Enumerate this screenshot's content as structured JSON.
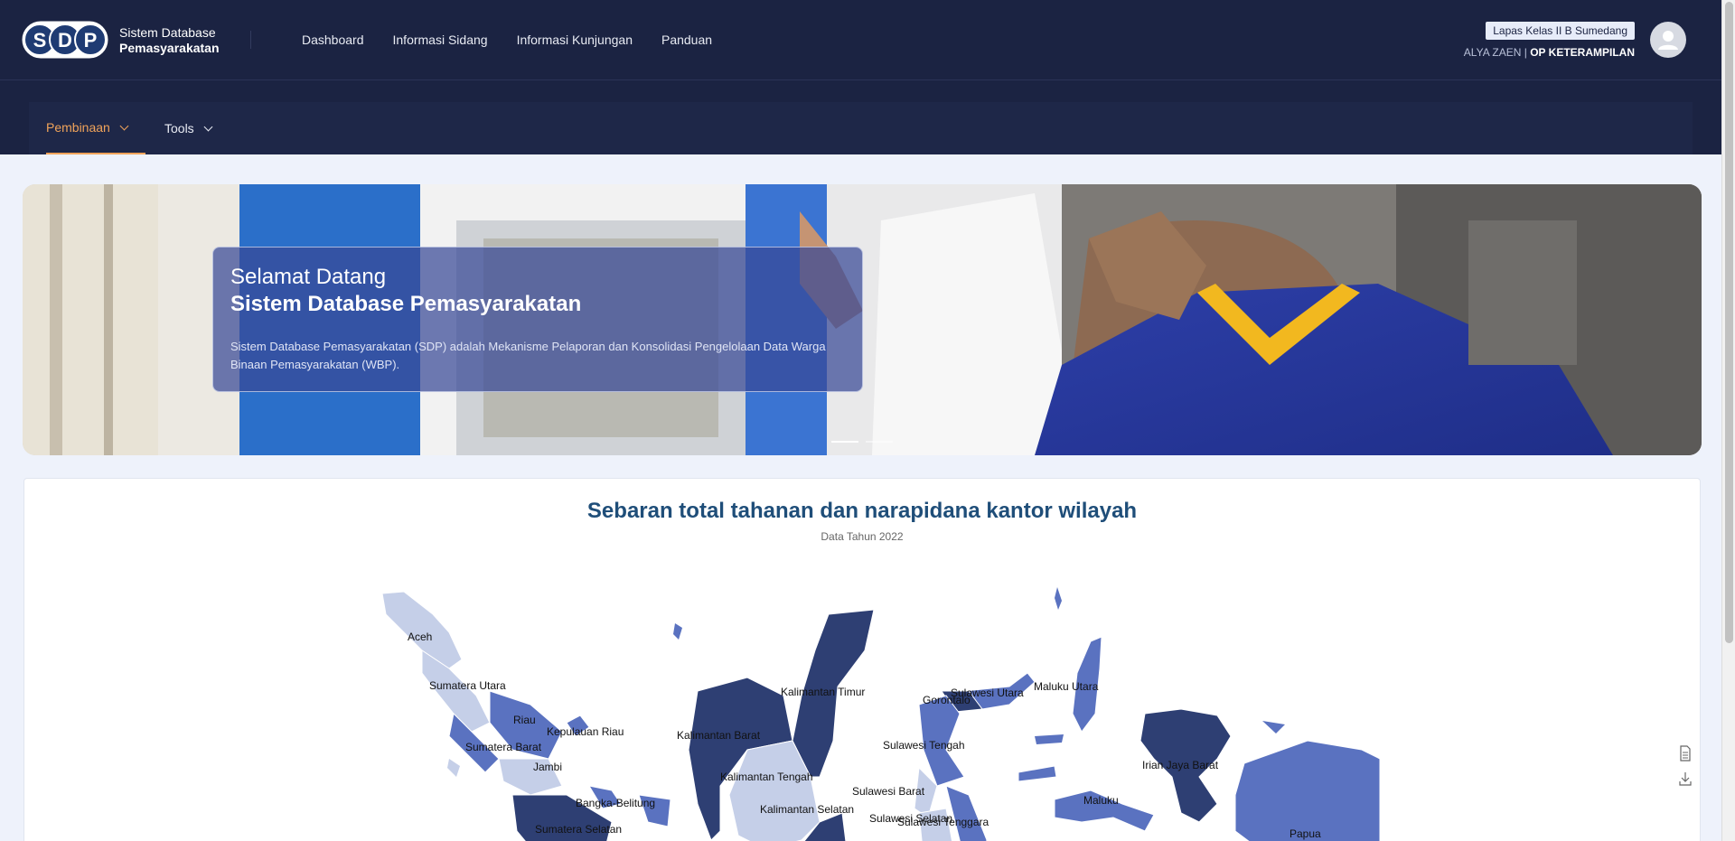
{
  "header": {
    "logo_text": "SDP",
    "brand_line1": "Sistem Database",
    "brand_line2": "Pemasyarakatan",
    "nav": [
      {
        "label": "Dashboard"
      },
      {
        "label": "Informasi Sidang"
      },
      {
        "label": "Informasi Kunjungan"
      },
      {
        "label": "Panduan"
      }
    ],
    "office_badge": "Lapas Kelas II B Sumedang",
    "user_name": "ALYA ZAEN",
    "separator": "|",
    "user_role": "OP KETERAMPILAN"
  },
  "submenu": {
    "items": [
      {
        "label": "Pembinaan",
        "active": true
      },
      {
        "label": "Tools",
        "active": false
      }
    ]
  },
  "hero": {
    "greeting": "Selamat Datang",
    "title": "Sistem Database Pemasyarakatan",
    "description": "Sistem Database Pemasyarakatan (SDP) adalah Mekanisme Pelaporan dan Konsolidasi Pengelolaan Data Warga Binaan Pemasyarakatan (WBP).",
    "slides": 2,
    "active_slide": 1
  },
  "map": {
    "title": "Sebaran total tahanan dan narapidana kantor wilayah",
    "subtitle": "Data Tahun 2022",
    "regions": [
      {
        "name": "Aceh"
      },
      {
        "name": "Sumatera Utara"
      },
      {
        "name": "Riau"
      },
      {
        "name": "Kepulauan Riau"
      },
      {
        "name": "Sumatera Barat"
      },
      {
        "name": "Jambi"
      },
      {
        "name": "Bangka-Belitung"
      },
      {
        "name": "Sumatera Selatan"
      },
      {
        "name": "Kalimantan Timur"
      },
      {
        "name": "Kalimantan Barat"
      },
      {
        "name": "Kalimantan Tengah"
      },
      {
        "name": "Kalimantan Selatan"
      },
      {
        "name": "Sulawesi Utara"
      },
      {
        "name": "Gorontalo"
      },
      {
        "name": "Sulawesi Tengah"
      },
      {
        "name": "Sulawesi Barat"
      },
      {
        "name": "Sulawesi Selatan"
      },
      {
        "name": "Sulawesi Tenggara"
      },
      {
        "name": "Maluku Utara"
      },
      {
        "name": "Maluku"
      },
      {
        "name": "Irian Jaya Barat"
      },
      {
        "name": "Papua"
      }
    ],
    "colors": {
      "dark": "#2e3f73",
      "mid": "#5a72c0",
      "light": "#c5cfe8"
    }
  },
  "tools": {
    "doc_icon": "document-icon",
    "download_icon": "download-icon"
  }
}
